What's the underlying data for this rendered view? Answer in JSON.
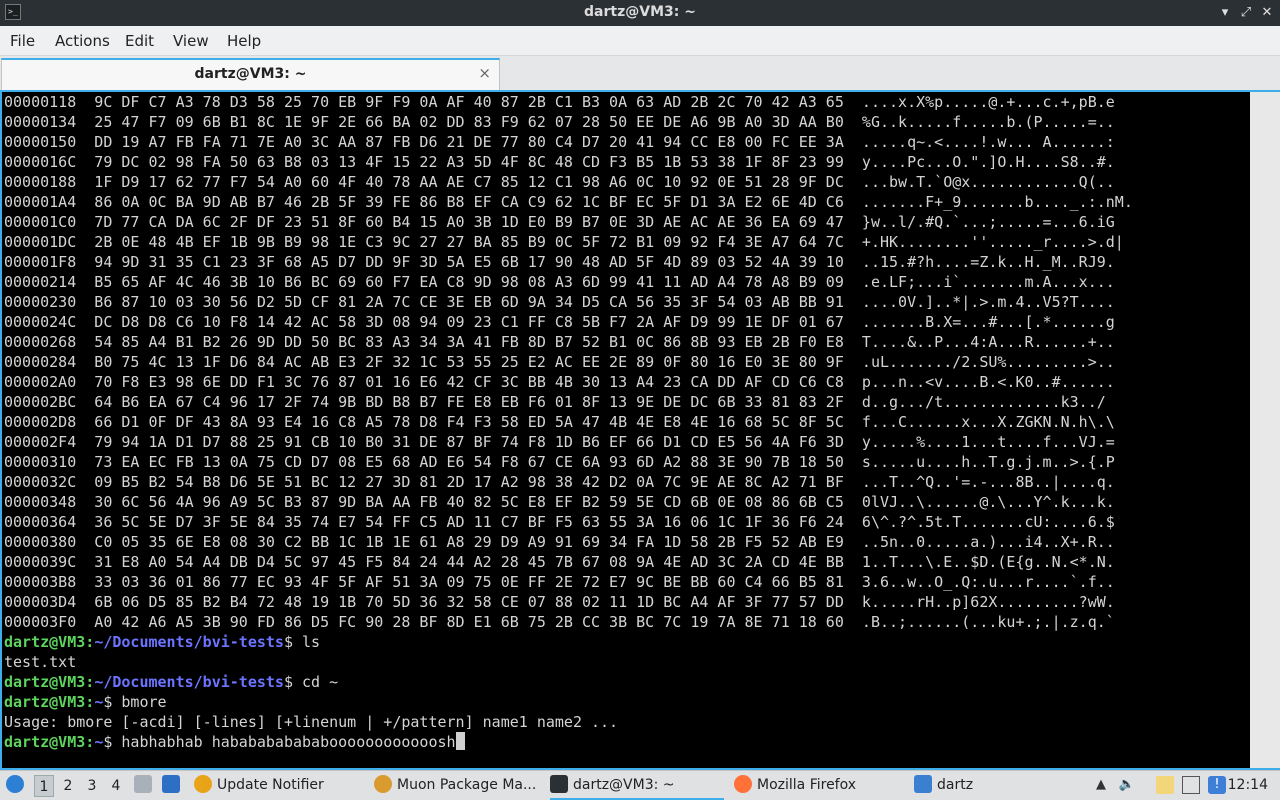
{
  "window": {
    "title": "dartz@VM3: ~"
  },
  "menu": [
    "File",
    "Actions",
    "Edit",
    "View",
    "Help"
  ],
  "tab": {
    "label": "dartz@VM3: ~",
    "close": "×"
  },
  "terminal": {
    "hexdump": [
      "00000118  9C DF C7 A3 78 D3 58 25 70 EB 9F F9 0A AF 40 87 2B C1 B3 0A 63 AD 2B 2C 70 42 A3 65  ....x.X%p.....@.+...c.+,pB.e",
      "00000134  25 47 F7 09 6B B1 8C 1E 9F 2E 66 BA 02 DD 83 F9 62 07 28 50 EE DE A6 9B A0 3D AA B0  %G..k.....f.....b.(P.....=..",
      "00000150  DD 19 A7 FB FA 71 7E A0 3C AA 87 FB D6 21 DE 77 80 C4 D7 20 41 94 CC E8 00 FC EE 3A  .....q~.<....!.w... A......:",
      "0000016C  79 DC 02 98 FA 50 63 B8 03 13 4F 15 22 A3 5D 4F 8C 48 CD F3 B5 1B 53 38 1F 8F 23 99  y....Pc...O.\".]O.H....S8..#.",
      "00000188  1F D9 17 62 77 F7 54 A0 60 4F 40 78 AA AE C7 85 12 C1 98 A6 0C 10 92 0E 51 28 9F DC  ...bw.T.`O@x............Q(..",
      "000001A4  86 0A 0C BA 9D AB B7 46 2B 5F 39 FE 86 B8 EF CA C9 62 1C BF EC 5F D1 3A E2 6E 4D C6  .......F+_9.......b...._.:.nM.",
      "000001C0  7D 77 CA DA 6C 2F DF 23 51 8F 60 B4 15 A0 3B 1D E0 B9 B7 0E 3D AE AC AE 36 EA 69 47  }w..l/.#Q.`...;.....=...6.iG",
      "000001DC  2B 0E 48 4B EF 1B 9B B9 98 1E C3 9C 27 27 BA 85 B9 0C 5F 72 B1 09 92 F4 3E A7 64 7C  +.HK........''....._r....>.d|",
      "000001F8  94 9D 31 35 C1 23 3F 68 A5 D7 DD 9F 3D 5A E5 6B 17 90 48 AD 5F 4D 89 03 52 4A 39 10  ..15.#?h....=Z.k..H._M..RJ9.",
      "00000214  B5 65 AF 4C 46 3B 10 B6 BC 69 60 F7 EA C8 9D 98 08 A3 6D 99 41 11 AD A4 78 A8 B9 09  .e.LF;...i`.......m.A...x...",
      "00000230  B6 87 10 03 30 56 D2 5D CF 81 2A 7C CE 3E EB 6D 9A 34 D5 CA 56 35 3F 54 03 AB BB 91  ....0V.]..*|.>.m.4..V5?T....",
      "0000024C  DC D8 D8 C6 10 F8 14 42 AC 58 3D 08 94 09 23 C1 FF C8 5B F7 2A AF D9 99 1E DF 01 67  .......B.X=...#...[.*......g",
      "00000268  54 85 A4 B1 B2 26 9D DD 50 BC 83 A3 34 3A 41 FB 8D B7 52 B1 0C 86 8B 93 EB 2B F0 E8  T....&..P...4:A...R......+..",
      "00000284  B0 75 4C 13 1F D6 84 AC AB E3 2F 32 1C 53 55 25 E2 AC EE 2E 89 0F 80 16 E0 3E 80 9F  .uL......./2.SU%.........>..",
      "000002A0  70 F8 E3 98 6E DD F1 3C 76 87 01 16 E6 42 CF 3C BB 4B 30 13 A4 23 CA DD AF CD C6 C8  p...n..<v....B.<.K0..#......",
      "000002BC  64 B6 EA 67 C4 96 17 2F 74 9B BD B8 B7 FE E8 EB F6 01 8F 13 9E DE DC 6B 33 81 83 2F  d..g.../t.............k3../",
      "000002D8  66 D1 0F DF 43 8A 93 E4 16 C8 A5 78 D8 F4 F3 58 ED 5A 47 4B 4E E8 4E 16 68 5C 8F 5C  f...C......x...X.ZGKN.N.h\\.\\",
      "000002F4  79 94 1A D1 D7 88 25 91 CB 10 B0 31 DE 87 BF 74 F8 1D B6 EF 66 D1 CD E5 56 4A F6 3D  y.....%....1...t....f...VJ.=",
      "00000310  73 EA EC FB 13 0A 75 CD D7 08 E5 68 AD E6 54 F8 67 CE 6A 93 6D A2 88 3E 90 7B 18 50  s.....u....h..T.g.j.m..>.{.P",
      "0000032C  09 B5 B2 54 B8 D6 5E 51 BC 12 27 3D 81 2D 17 A2 98 38 42 D2 0A 7C 9E AE 8C A2 71 BF  ...T..^Q..'=.-...8B..|....q.",
      "00000348  30 6C 56 4A 96 A9 5C B3 87 9D BA AA FB 40 82 5C E8 EF B2 59 5E CD 6B 0E 08 86 6B C5  0lVJ..\\......@.\\...Y^.k...k.",
      "00000364  36 5C 5E D7 3F 5E 84 35 74 E7 54 FF C5 AD 11 C7 BF F5 63 55 3A 16 06 1C 1F 36 F6 24  6\\^.?^.5t.T.......cU:....6.$",
      "00000380  C0 05 35 6E E8 08 30 C2 BB 1C 1B 1E 61 A8 29 D9 A9 91 69 34 FA 1D 58 2B F5 52 AB E9  ..5n..0.....a.)...i4..X+.R..",
      "0000039C  31 E8 A0 54 A4 DB D4 5C 97 45 F5 84 24 44 A2 28 45 7B 67 08 9A 4E AD 3C 2A CD 4E BB  1..T...\\.E..$D.(E{g..N.<*.N.",
      "000003B8  33 03 36 01 86 77 EC 93 4F 5F AF 51 3A 09 75 0E FF 2E 72 E7 9C BE BB 60 C4 66 B5 81  3.6..w..O_.Q:.u...r....`.f..",
      "000003D4  6B 06 D5 85 B2 B4 72 48 19 1B 70 5D 36 32 58 CE 07 88 02 11 1D BC A4 AF 3F 77 57 DD  k.....rH..p]62X.........?wW.",
      "000003F0  A0 42 A6 A5 3B 90 FD 86 D5 FC 90 28 BF 8D E1 6B 75 2B CC 3B BC 7C 19 7A 8E 71 18 60  .B..;......(...ku+.;.|.z.q.`"
    ],
    "session": [
      {
        "user": "dartz@VM3",
        "path": "~/Documents/bvi-tests",
        "cmd": "ls"
      },
      {
        "output": "test.txt"
      },
      {
        "user": "dartz@VM3",
        "path": "~/Documents/bvi-tests",
        "cmd": "cd ~"
      },
      {
        "user": "dartz@VM3",
        "path": "~",
        "cmd": "bmore"
      },
      {
        "output": "Usage: bmore [-acdi] [-lines] [+linenum | +/pattern] name1 name2 ..."
      },
      {
        "user": "dartz@VM3",
        "path": "~",
        "cmd": "habhabhab hababababababoooooooooooosh",
        "cursor": true
      }
    ]
  },
  "taskbar": {
    "workspaces": [
      "1",
      "2",
      "3",
      "4"
    ],
    "active_workspace": "1",
    "tasks": [
      {
        "label": "Update Notifier",
        "icon": "update-notifier-icon",
        "color": "#e8a317"
      },
      {
        "label": "Muon Package Ma...",
        "icon": "package-manager-icon",
        "color": "#d99a2e"
      },
      {
        "label": "dartz@VM3: ~",
        "icon": "terminal-icon",
        "color": "#2b3035"
      },
      {
        "label": "Mozilla Firefox",
        "icon": "firefox-icon",
        "color": "#ff7139"
      },
      {
        "label": "dartz",
        "icon": "folder-icon",
        "color": "#3a7fd0"
      }
    ],
    "clock": "12:14"
  },
  "colors": {
    "accent": "#3daee9",
    "prompt_user": "#5ed45e",
    "prompt_path": "#6b74ff"
  }
}
